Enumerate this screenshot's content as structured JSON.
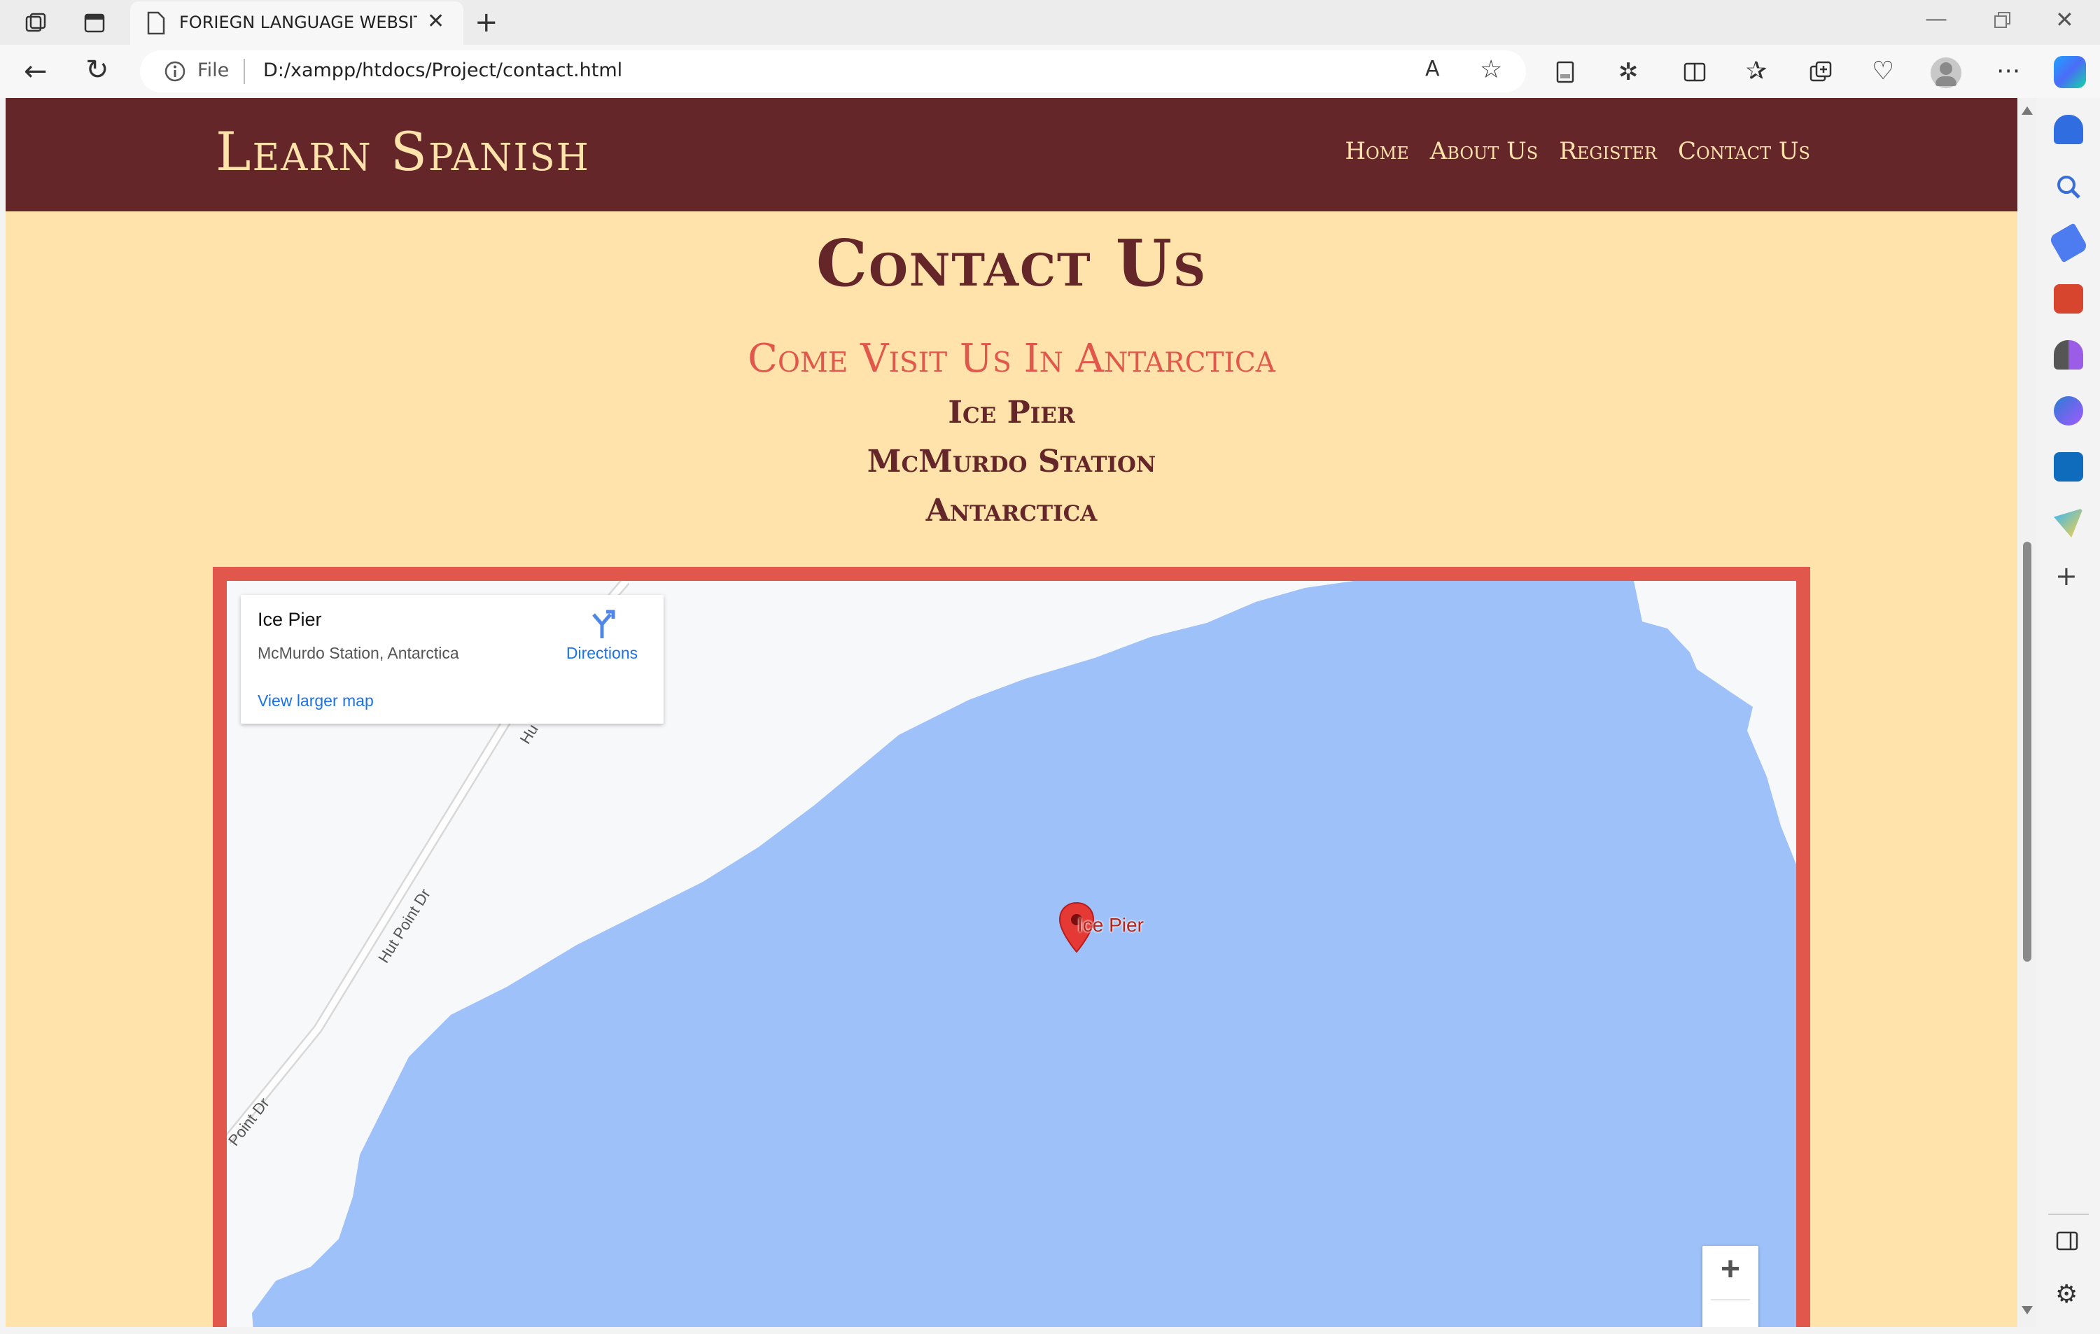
{
  "browser": {
    "tab_title": "FORIEGN LANGUAGE WEBSITE R",
    "address_prefix": "File",
    "url": "D:/xampp/htdocs/Project/contact.html"
  },
  "site": {
    "logo": "Learn Spanish",
    "nav": [
      "Home",
      "About Us",
      "Register",
      "Contact Us"
    ],
    "heading": "Contact Us",
    "visit": "Come Visit Us In Antarctica",
    "address_lines": [
      "Ice Pier",
      "McMurdo Station",
      "Antarctica"
    ]
  },
  "map": {
    "place_title": "Ice Pier",
    "place_sub": "McMurdo Station, Antarctica",
    "view_larger": "View larger map",
    "directions": "Directions",
    "pin_label": "Ice Pier",
    "road_labels": [
      "Hut Point Dr",
      "Point Dr",
      "Hu"
    ],
    "zoom_in": "+",
    "water_color": "#9dc1f8",
    "frame_color": "#e2574c"
  },
  "theme": {
    "brand": "#642628",
    "background": "#ffe3ab",
    "accent": "#e2574c"
  }
}
